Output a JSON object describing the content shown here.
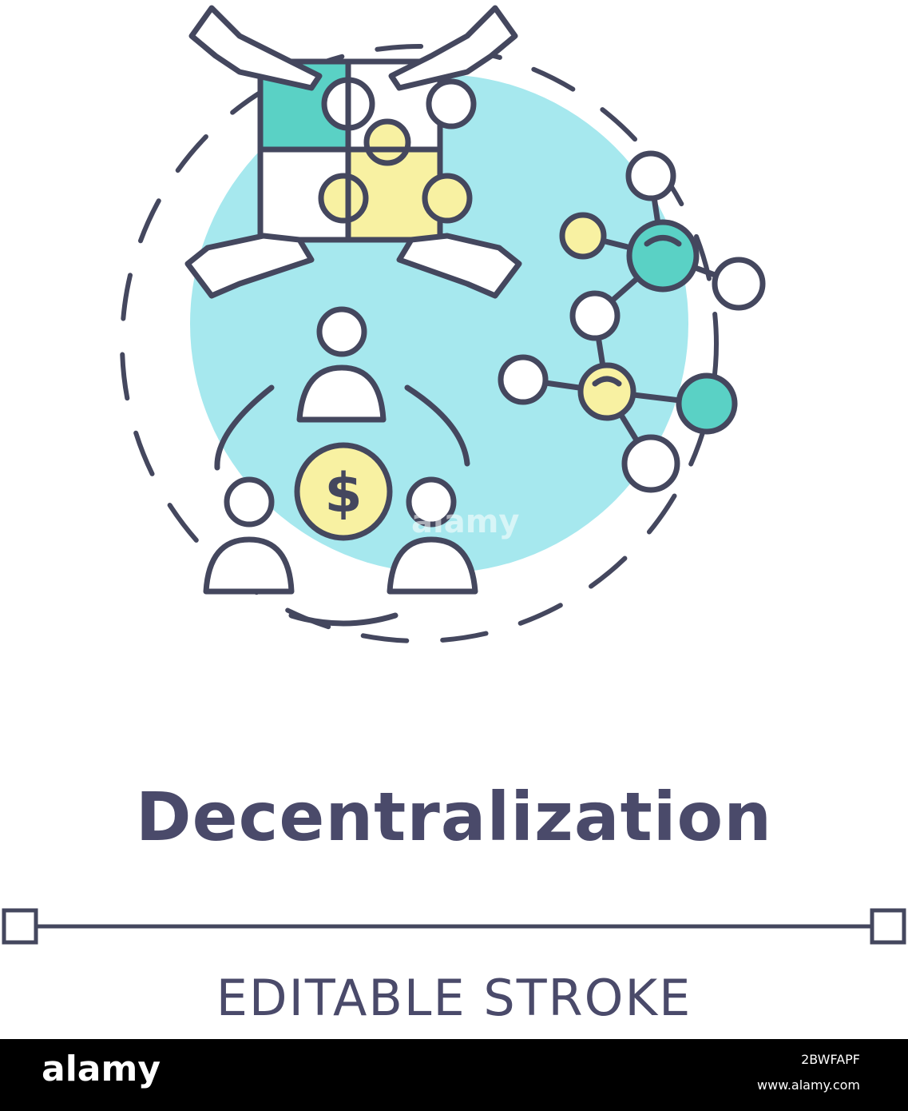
{
  "illustration": {
    "name": "decentralization-concept-icon",
    "colors": {
      "stroke": "#44475e",
      "circle_fill": "#a6e8ee",
      "teal": "#5ad1c5",
      "yellow": "#f8f1a2",
      "white": "#ffffff"
    },
    "coin_symbol": "$"
  },
  "title": "Decentralization",
  "subtitle": "EDITABLE STROKE",
  "watermark": "alamy",
  "footer": {
    "logo": "alamy",
    "image_id": "2BWFAPF",
    "url": "www.alamy.com",
    "background": "#000000"
  }
}
